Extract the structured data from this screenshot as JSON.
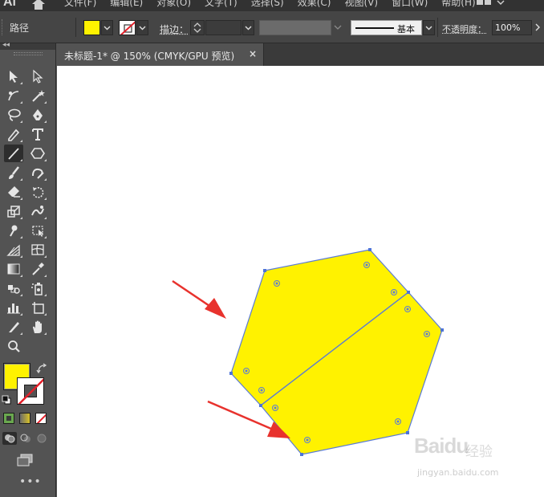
{
  "app": {
    "logo": "Ai",
    "menus": [
      "文件(F)",
      "编辑(E)",
      "对象(O)",
      "文字(T)",
      "选择(S)",
      "效果(C)",
      "视图(V)",
      "窗口(W)",
      "帮助(H)"
    ]
  },
  "controlbar": {
    "selection_label": "路径",
    "fill_color": "#fff200",
    "stroke_label": "描边：",
    "brush_label": "基本",
    "opacity_label": "不透明度：",
    "opacity_value": "100%"
  },
  "document": {
    "tab_title": "未标题-1* @ 150% (CMYK/GPU 预览)",
    "close_symbol": "×"
  },
  "toolbar": {
    "tools": [
      "selection-tool",
      "direct-selection-tool",
      "curvature-tool",
      "magic-wand-tool",
      "lasso-tool",
      "pen-tool",
      "pencil-tool",
      "type-tool",
      "line-segment-tool",
      "polygon-tool",
      "paintbrush-tool",
      "shaper-tool",
      "eraser-tool",
      "rotate-tool",
      "scale-tool",
      "warp-tool",
      "puppet-warp-tool",
      "free-transform-tool",
      "perspective-grid-tool",
      "mesh-tool",
      "gradient-tool",
      "eyedropper-tool",
      "blend-tool",
      "symbol-sprayer-tool",
      "column-graph-tool",
      "artboard-tool",
      "slice-tool",
      "hand-tool",
      "zoom-tool"
    ],
    "active_tool": "line-segment-tool",
    "fill_color": "#fff200",
    "stroke_color": "none",
    "more": "•••"
  },
  "artwork": {
    "shape_fill": "#fff200",
    "path_color": "#4a6fd1",
    "arrow_color": "#e8322d",
    "description_hidden": ""
  },
  "watermark": {
    "logo": "Baidu",
    "sub": "经验",
    "url": "jingyan.baidu.com"
  }
}
